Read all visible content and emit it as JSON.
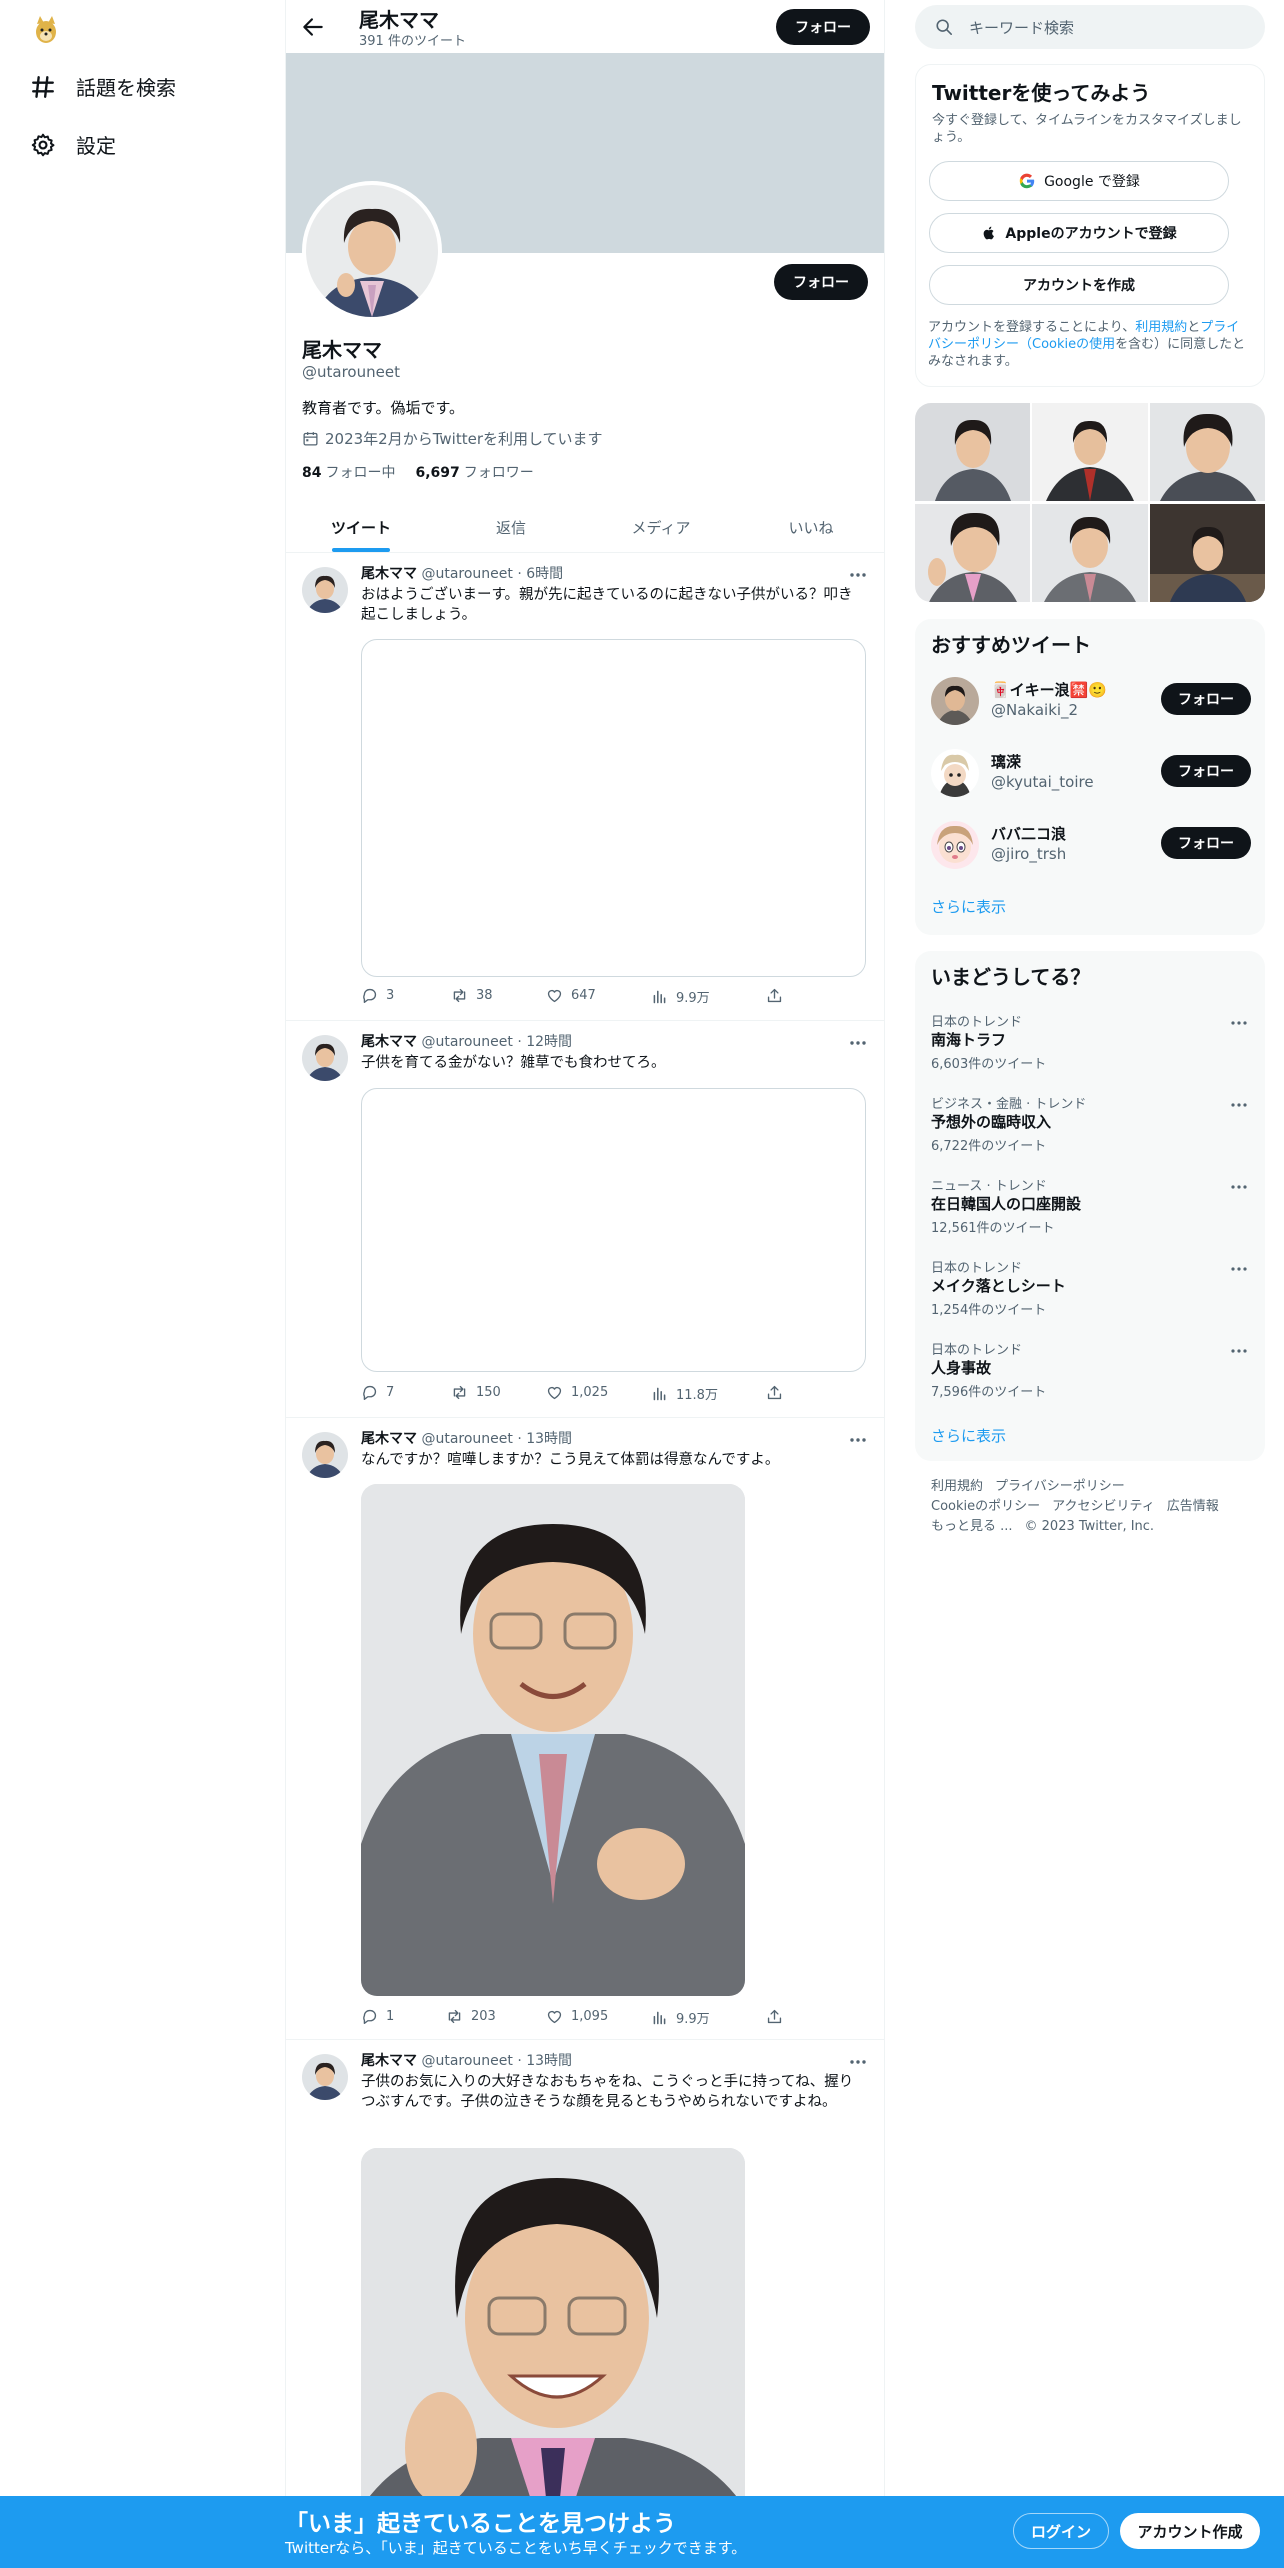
{
  "nav": {
    "explore": "話題を検索",
    "settings": "設定"
  },
  "header": {
    "name": "尾木ママ",
    "tweet_count": "391 件のツイート",
    "follow": "フォロー"
  },
  "profile": {
    "name": "尾木ママ",
    "handle": "@utarouneet",
    "bio": "教育者です。偽垢です。",
    "joined": "2023年2月からTwitterを利用しています",
    "following_count": "84",
    "following_label": "フォロー中",
    "followers_count": "6,697",
    "followers_label": "フォロワー",
    "follow": "フォロー"
  },
  "tabs": [
    "ツイート",
    "返信",
    "メディア",
    "いいね"
  ],
  "tweets": [
    {
      "name": "尾木ママ",
      "handle": "@utarouneet",
      "time": "6時間",
      "text": "おはようございまーす。親が先に起きているのに起きない子供がいる？叩き起こしましょう。",
      "replies": "3",
      "retweets": "38",
      "likes": "647",
      "views": "9.9万"
    },
    {
      "name": "尾木ママ",
      "handle": "@utarouneet",
      "time": "12時間",
      "text": "子供を育てる金がない？雑草でも食わせてろ。",
      "replies": "7",
      "retweets": "150",
      "likes": "1,025",
      "views": "11.8万"
    },
    {
      "name": "尾木ママ",
      "handle": "@utarouneet",
      "time": "13時間",
      "text": "なんですか？喧嘩しますか？こう見えて体罰は得意なんですよ。",
      "replies": "1",
      "retweets": "203",
      "likes": "1,095",
      "views": "9.9万"
    },
    {
      "name": "尾木ママ",
      "handle": "@utarouneet",
      "time": "13時間",
      "text": "子供のお気に入りの大好きなおもちゃをね、こうぐっと手に持ってね、握りつぶすんです。子供の泣きそうな顔を見るともうやめられないですよね。"
    }
  ],
  "search": {
    "placeholder": "キーワード検索"
  },
  "signup": {
    "title": "Twitterを使ってみよう",
    "subtitle": "今すぐ登録して、タイムラインをカスタマイズしましょう。",
    "google": "Google で登録",
    "apple": "Appleのアカウントで登録",
    "create": "アカウントを作成",
    "terms_1": "アカウントを登録することにより、",
    "terms_link1": "利用規約",
    "terms_2": "と",
    "terms_link2": "プライバシーポリシー（Cookieの使用",
    "terms_3": "を含む）に同意したとみなされます。"
  },
  "who_to_follow": {
    "title": "おすすめツイート",
    "accounts": [
      {
        "name": "🀄イキー浪🈲🙂",
        "handle": "@Nakaiki_2",
        "follow": "フォロー"
      },
      {
        "name": "璃溁",
        "handle": "@kyutai_toire",
        "follow": "フォロー"
      },
      {
        "name": "ババ二コ浪",
        "handle": "@jiro_trsh",
        "follow": "フォロー"
      }
    ],
    "show_more": "さらに表示"
  },
  "trends": {
    "title": "いまどうしてる？",
    "items": [
      {
        "context": "日本のトレンド",
        "topic": "南海トラフ",
        "count": "6,603件のツイート"
      },
      {
        "context": "ビジネス・金融 · トレンド",
        "topic": "予想外の臨時収入",
        "count": "6,722件のツイート"
      },
      {
        "context": "ニュース · トレンド",
        "topic": "在日韓国人の口座開設",
        "count": "12,561件のツイート"
      },
      {
        "context": "日本のトレンド",
        "topic": "メイク落としシート",
        "count": "1,254件のツイート"
      },
      {
        "context": "日本のトレンド",
        "topic": "人身事故",
        "count": "7,596件のツイート"
      }
    ],
    "show_more": "さらに表示"
  },
  "footer": {
    "terms": "利用規約",
    "privacy": "プライバシーポリシー",
    "cookie": "Cookieのポリシー",
    "accessibility": "アクセシビリティ",
    "ads": "広告情報",
    "more": "もっと見る ...",
    "copyright": "© 2023 Twitter, Inc."
  },
  "bottom_bar": {
    "title": "「いま」起きていることを見つけよう",
    "subtitle": "Twitterなら、「いま」起きていることをいち早くチェックできます。",
    "login": "ログイン",
    "signup": "アカウント作成"
  },
  "colors": {
    "accent": "#1d9bf0",
    "text": "#0f1419",
    "muted": "#536471",
    "banner": "#cfd9de"
  }
}
